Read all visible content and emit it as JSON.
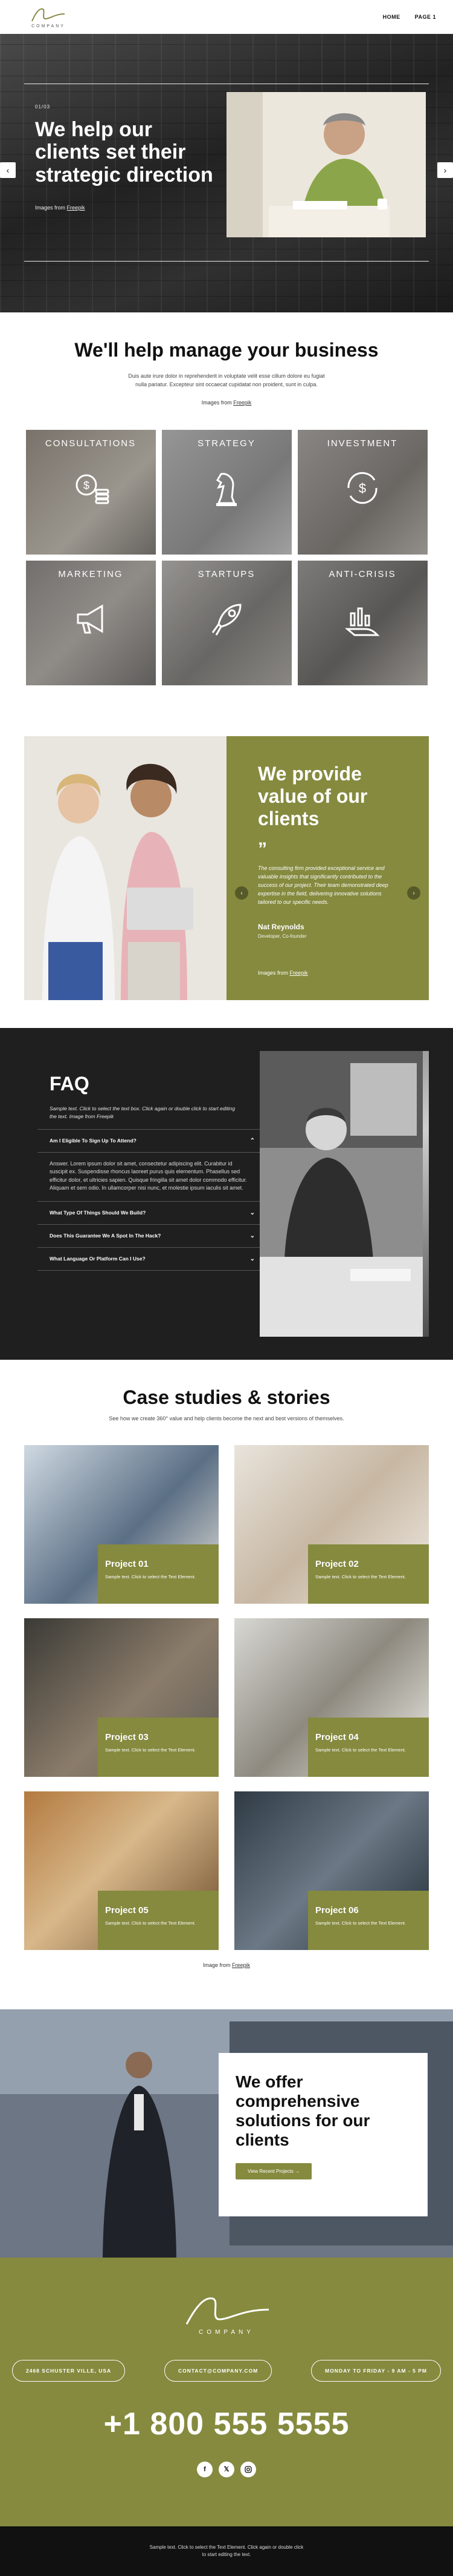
{
  "header": {
    "logo_text": "COMPANY",
    "nav": [
      "HOME",
      "PAGE 1"
    ]
  },
  "hero": {
    "eyebrow": "01/03",
    "title": "We help our clients set their strategic direction",
    "credit_prefix": "Images from ",
    "credit_link": "Freepik"
  },
  "services": {
    "title": "We'll help manage your business",
    "lead": "Duis aute irure dolor in reprehenderit in voluptate velit esse cillum dolore eu fugiat nulla pariatur. Excepteur sint occaecat cupidatat non proident, sunt in culpa.",
    "credit_prefix": "Images from ",
    "credit_link": "Freepik",
    "tiles": [
      {
        "label": "CONSULTATIONS",
        "icon": "coins-icon"
      },
      {
        "label": "STRATEGY",
        "icon": "chess-knight-icon"
      },
      {
        "label": "INVESTMENT",
        "icon": "dollar-cycle-icon"
      },
      {
        "label": "MARKETING",
        "icon": "megaphone-icon"
      },
      {
        "label": "STARTUPS",
        "icon": "rocket-icon"
      },
      {
        "label": "ANTI-CRISIS",
        "icon": "chart-hand-icon"
      }
    ]
  },
  "value": {
    "title": "We provide value of our clients",
    "quote_mark": "”",
    "quote": "The consulting firm provided exceptional service and valuable insights that significantly contributed to the success of our project. Their team demonstrated deep expertise in the field, delivering innovative solutions tailored to our specific needs.",
    "name": "Nat Reynolds",
    "role": "Developer, Co-founder",
    "credit_prefix": "Images from ",
    "credit_link": "Freepik"
  },
  "faq": {
    "title": "FAQ",
    "subtitle": "Sample text. Click to select the text box. Click again or double click to start editing the text. Image from Freepik",
    "items": [
      {
        "q": "Am I Eligible To Sign Up To Attend?",
        "a": "Answer. Lorem ipsum dolor sit amet, consectetur adipiscing elit. Curabitur id suscipit ex. Suspendisse rhoncus laoreet purus quis elementum. Phasellus sed efficitur dolor, et ultricies sapien. Quisque fringilla sit amet dolor commodo efficitur. Aliquam et sem odio. In ullamcorper nisi nunc, et molestie ipsum iaculis sit amet."
      },
      {
        "q": "What Type Of Things Should We Build?",
        "a": ""
      },
      {
        "q": "Does This Guarantee We A Spot In The Hack?",
        "a": ""
      },
      {
        "q": "What Language Or Platform Can I Use?",
        "a": ""
      }
    ]
  },
  "cases": {
    "title": "Case studies & stories",
    "subtitle": "See how we create 360° value and help clients become the next and best versions of themselves.",
    "items": [
      {
        "title": "Project 01",
        "text": "Sample text. Click to select the Text Element."
      },
      {
        "title": "Project 02",
        "text": "Sample text. Click to select the Text Element."
      },
      {
        "title": "Project 03",
        "text": "Sample text. Click to select the Text Element."
      },
      {
        "title": "Project 04",
        "text": "Sample text. Click to select the Text Element."
      },
      {
        "title": "Project 05",
        "text": "Sample text. Click to select the Text Element."
      },
      {
        "title": "Project 06",
        "text": "Sample text. Click to select the Text Element."
      }
    ],
    "credit_prefix": "Image from ",
    "credit_link": "Freepik"
  },
  "offer": {
    "title": "We offer comprehensive solutions for our clients",
    "button": "View Recent Projects  →"
  },
  "footer": {
    "logo_text": "COMPANY",
    "address": "2468 SCHUSTER VILLE, USA",
    "email": "CONTACT@COMPANY.COM",
    "hours": "MONDAY TO FRIDAY - 9 AM - 5 PM",
    "phone": "+1 800 555 5555",
    "socials": [
      "facebook-icon",
      "x-icon",
      "instagram-icon"
    ],
    "bottom_text": "Sample text. Click to select the Text Element. Click again or double click to start editing the text."
  },
  "colors": {
    "accent": "#858a3f",
    "dark": "#1f1f1f"
  }
}
